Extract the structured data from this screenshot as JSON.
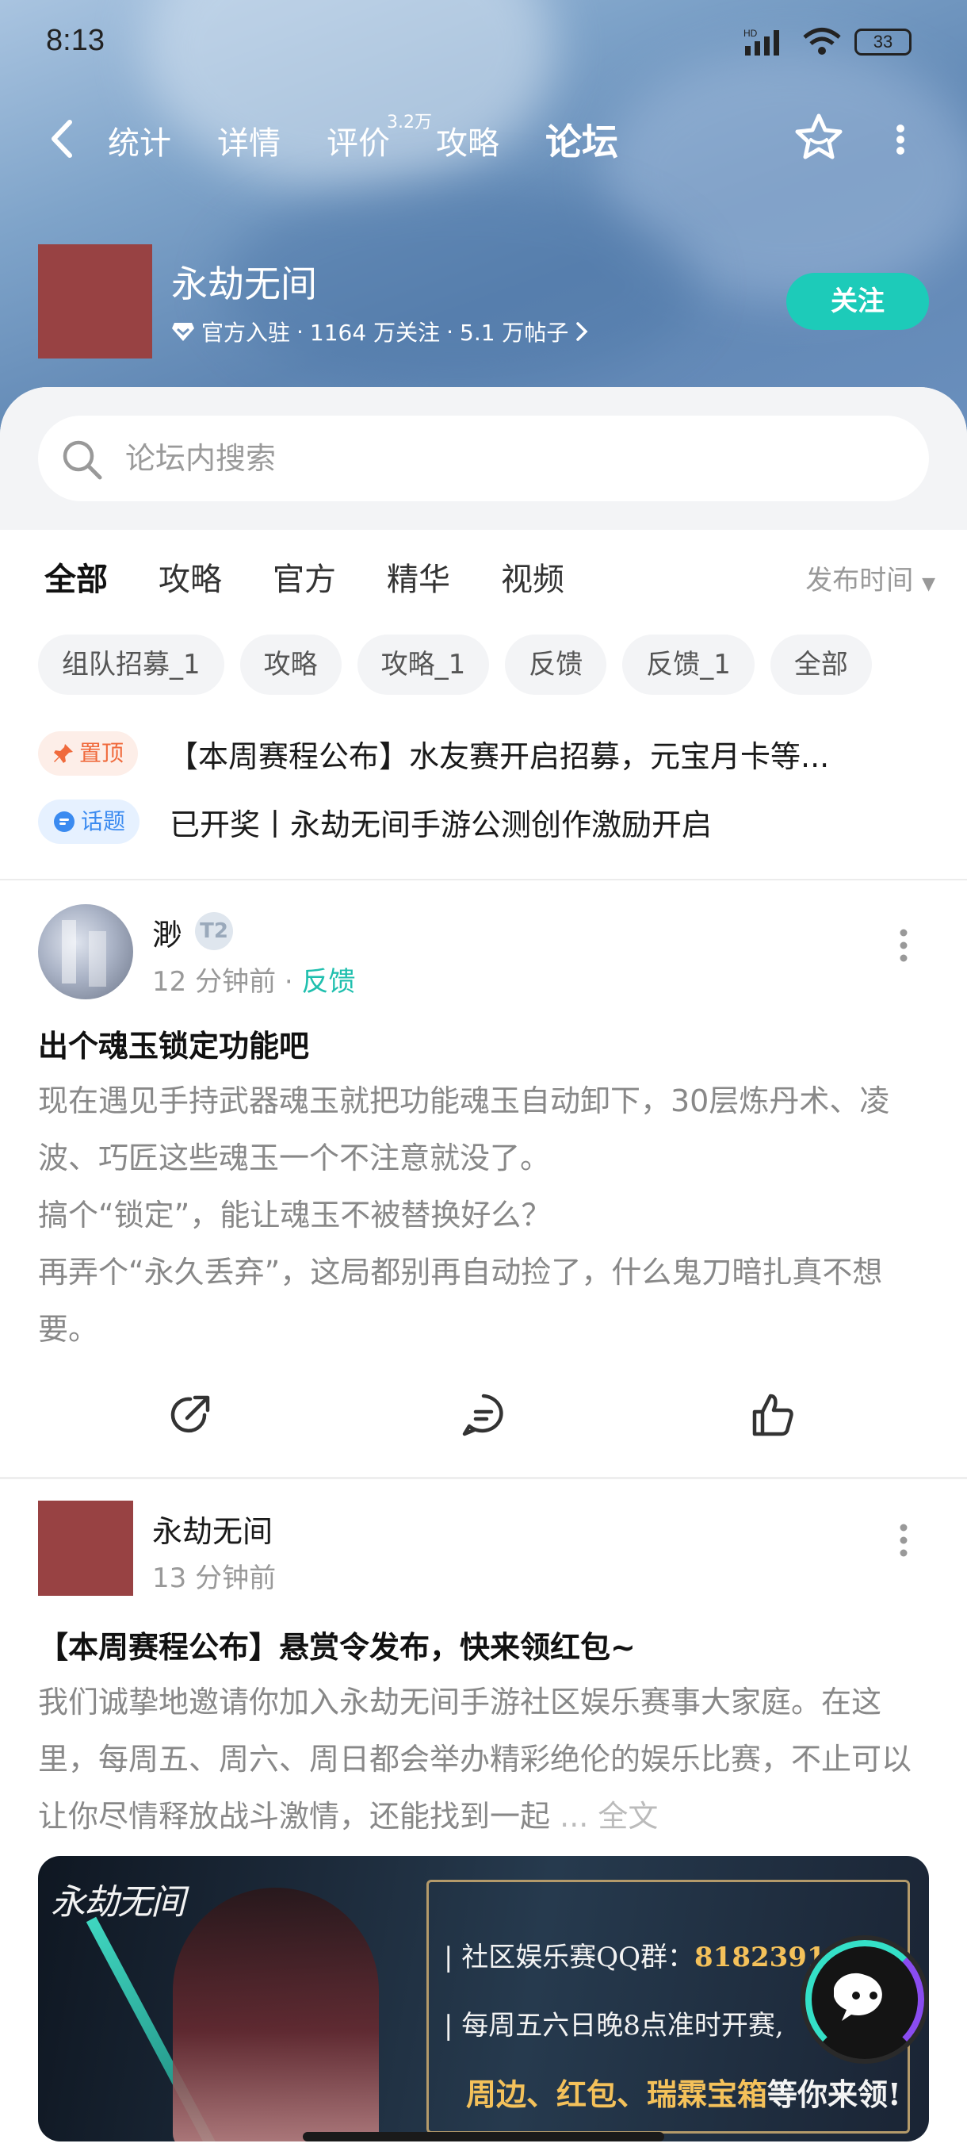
{
  "status_bar": {
    "time": "8:13",
    "network": "HD",
    "battery": "33"
  },
  "nav": {
    "tabs": [
      {
        "label": "统计"
      },
      {
        "label": "详情"
      },
      {
        "label": "评价",
        "badge": "3.2万"
      },
      {
        "label": "攻略"
      },
      {
        "label": "论坛",
        "active": true
      }
    ]
  },
  "game": {
    "name": "永劫无间",
    "verified_label": "官方入驻",
    "followers": "1164 万关注",
    "posts": "5.1 万帖子",
    "follow_button": "关注"
  },
  "search": {
    "placeholder": "论坛内搜索"
  },
  "filter_tabs": [
    {
      "label": "全部",
      "active": true
    },
    {
      "label": "攻略"
    },
    {
      "label": "官方"
    },
    {
      "label": "精华"
    },
    {
      "label": "视频"
    }
  ],
  "sort": {
    "label": "发布时间"
  },
  "chips": [
    "组队招募_1",
    "攻略",
    "攻略_1",
    "反馈",
    "反馈_1",
    "全部"
  ],
  "pinned": [
    {
      "tag": "置顶",
      "text": "【本周赛程公布】水友赛开启招募，元宝月卡等..."
    },
    {
      "tag": "话题",
      "text": "已开奖丨永劫无间手游公测创作激励开启"
    }
  ],
  "posts": [
    {
      "author": "渺",
      "level": "T2",
      "time": "12 分钟前",
      "category": "反馈",
      "title": "出个魂玉锁定功能吧",
      "body": [
        "现在遇见手持武器魂玉就把功能魂玉自动卸下，30层炼丹术、凌波、巧匠这些魂玉一个不注意就没了。",
        "搞个“锁定”，能让魂玉不被替换好么？",
        "再弄个“永久丢弃”，这局都别再自动捡了，什么鬼刀暗扎真不想要。"
      ]
    },
    {
      "author": "永劫无间",
      "time": "13 分钟前",
      "title": "【本周赛程公布】悬赏令发布，快来领红包~",
      "body_text": "我们诚挚地邀请你加入永劫无间手游社区娱乐赛事大家庭。在这里，每周五、周六、周日都会举办精彩绝伦的娱乐比赛，不止可以让你尽情释放战斗激情，还能找到一起",
      "more": "... 全文",
      "banner": {
        "logo_text": "永劫无间",
        "line1_label": "社区娱乐赛QQ群：",
        "line1_value": "818239115",
        "line2": "每周五六日晚8点准时开赛,",
        "line3_gold": "周边、红包、瑞霖宝箱",
        "line3_rest": "等你来领!"
      }
    }
  ],
  "colors": {
    "accent": "#1dcbb9",
    "pin_tag": "#f06a3c",
    "topic_tag": "#3b8bf0",
    "brand_logo": "#984243"
  }
}
